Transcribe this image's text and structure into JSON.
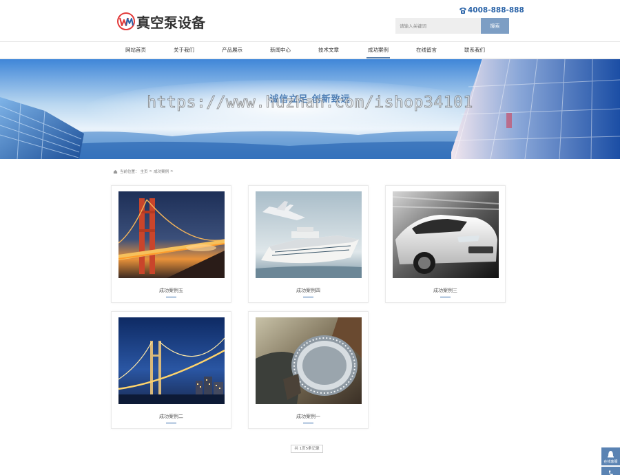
{
  "header": {
    "logo_text": "真空泵设备",
    "hotline": "4008-888-888",
    "search": {
      "placeholder": "请输入关键词",
      "button_label": "搜索"
    }
  },
  "nav": {
    "items": [
      {
        "label": "网站首页"
      },
      {
        "label": "关于我们"
      },
      {
        "label": "产品展示"
      },
      {
        "label": "新闻中心"
      },
      {
        "label": "技术文章"
      },
      {
        "label": "成功案例",
        "active": true
      },
      {
        "label": "在线留言"
      },
      {
        "label": "联系我们"
      }
    ]
  },
  "banner": {
    "title": "诚信立足 创新致远",
    "watermark": "https://www.huzhan.com/ishop34101"
  },
  "breadcrumb": {
    "prefix": "当前位置：",
    "home": "主页",
    "sep": ">",
    "current": "成功案例",
    "trail": ">"
  },
  "cases": [
    {
      "title": "成功案例五",
      "icon": "golden-gate-bridge-photo"
    },
    {
      "title": "成功案例四",
      "icon": "cruise-ship-airplane-photo"
    },
    {
      "title": "成功案例三",
      "icon": "white-car-photo"
    },
    {
      "title": "成功案例二",
      "icon": "night-bridge-photo"
    },
    {
      "title": "成功案例一",
      "icon": "wristwatch-photo"
    }
  ],
  "pagination": {
    "text": "共 1页5条记录"
  },
  "side": {
    "chat_label": "在线客服"
  },
  "colors": {
    "accent": "#2b64a8",
    "search_button": "#7d9ec4",
    "side_float": "#5a83b3"
  }
}
